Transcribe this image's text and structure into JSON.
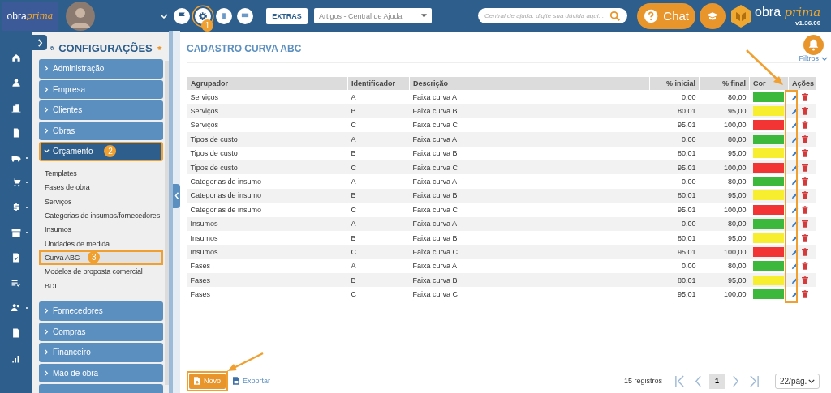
{
  "topbar": {
    "logo": {
      "word": "obra",
      "script": "prima"
    },
    "tools": [
      {
        "kind": "flag",
        "selected": false
      },
      {
        "kind": "gear",
        "selected": true,
        "badge": "1"
      },
      {
        "kind": "phone",
        "selected": false
      },
      {
        "kind": "monitor",
        "selected": false
      }
    ],
    "extras_button": "EXTRAS",
    "help_select": {
      "value": "Artigos - Central de Ajuda"
    },
    "help_search": {
      "placeholder": "Central de ajuda: digite sua dúvida aqui..."
    },
    "chat_button": "Chat",
    "brand": {
      "word": "obra",
      "script": "prima",
      "version": "v1.36.00"
    }
  },
  "rail": [
    {
      "kind": "home",
      "submenu": false
    },
    {
      "kind": "user",
      "submenu": false
    },
    {
      "kind": "building",
      "submenu": false
    },
    {
      "kind": "invoice",
      "submenu": false
    },
    {
      "kind": "truck",
      "submenu": true
    },
    {
      "kind": "cart",
      "submenu": true
    },
    {
      "kind": "dollar",
      "submenu": true
    },
    {
      "kind": "archive",
      "submenu": true
    },
    {
      "kind": "doc-check",
      "submenu": false
    },
    {
      "kind": "list-check",
      "submenu": false
    },
    {
      "kind": "people",
      "submenu": true
    },
    {
      "kind": "doc",
      "submenu": false
    },
    {
      "kind": "chart",
      "submenu": false
    }
  ],
  "sidebar": {
    "title": "CONFIGURAÇÕES",
    "sections": [
      {
        "label": "Administração",
        "expanded": false
      },
      {
        "label": "Empresa",
        "expanded": false
      },
      {
        "label": "Clientes",
        "expanded": false
      },
      {
        "label": "Obras",
        "expanded": false
      },
      {
        "label": "Orçamento",
        "expanded": true,
        "badge": "2",
        "children": [
          {
            "label": "Templates",
            "selected": false
          },
          {
            "label": "Fases de obra",
            "selected": false
          },
          {
            "label": "Serviços",
            "selected": false
          },
          {
            "label": "Categorias de insumos/fornecedores",
            "selected": false
          },
          {
            "label": "Insumos",
            "selected": false
          },
          {
            "label": "Unidades de medida",
            "selected": false
          },
          {
            "label": "Curva ABC",
            "selected": true,
            "badge": "3"
          },
          {
            "label": "Modelos de proposta comercial",
            "selected": false
          },
          {
            "label": "BDI",
            "selected": false
          }
        ]
      },
      {
        "label": "Fornecedores",
        "expanded": false
      },
      {
        "label": "Compras",
        "expanded": false
      },
      {
        "label": "Financeiro",
        "expanded": false
      },
      {
        "label": "Mão de obra",
        "expanded": false
      }
    ]
  },
  "page": {
    "title": "CADASTRO CURVA ABC",
    "filters": "Filtros",
    "table": {
      "actions_highlighted": true,
      "columns": [
        "Agrupador",
        "Identificador",
        "Descrição",
        "% inicial",
        "% final",
        "Cor",
        "Ações"
      ],
      "rows": [
        {
          "group": "Serviços",
          "id": "A",
          "description": "Faixa curva A",
          "start": "0,00",
          "end": "80,00",
          "color": "#3cb83c"
        },
        {
          "group": "Serviços",
          "id": "B",
          "description": "Faixa curva B",
          "start": "80,01",
          "end": "95,00",
          "color": "#f7ee2f"
        },
        {
          "group": "Serviços",
          "id": "C",
          "description": "Faixa curva C",
          "start": "95,01",
          "end": "100,00",
          "color": "#f23434"
        },
        {
          "group": "Tipos de custo",
          "id": "A",
          "description": "Faixa curva A",
          "start": "0,00",
          "end": "80,00",
          "color": "#3cb83c"
        },
        {
          "group": "Tipos de custo",
          "id": "B",
          "description": "Faixa curva B",
          "start": "80,01",
          "end": "95,00",
          "color": "#f7ee2f"
        },
        {
          "group": "Tipos de custo",
          "id": "C",
          "description": "Faixa curva C",
          "start": "95,01",
          "end": "100,00",
          "color": "#f23434"
        },
        {
          "group": "Categorias de insumo",
          "id": "A",
          "description": "Faixa curva A",
          "start": "0,00",
          "end": "80,00",
          "color": "#3cb83c"
        },
        {
          "group": "Categorias de insumo",
          "id": "B",
          "description": "Faixa curva B",
          "start": "80,01",
          "end": "95,00",
          "color": "#f7ee2f"
        },
        {
          "group": "Categorias de insumo",
          "id": "C",
          "description": "Faixa curva C",
          "start": "95,01",
          "end": "100,00",
          "color": "#f23434"
        },
        {
          "group": "Insumos",
          "id": "A",
          "description": "Faixa curva A",
          "start": "0,00",
          "end": "80,00",
          "color": "#3cb83c"
        },
        {
          "group": "Insumos",
          "id": "B",
          "description": "Faixa curva B",
          "start": "80,01",
          "end": "95,00",
          "color": "#f7ee2f"
        },
        {
          "group": "Insumos",
          "id": "C",
          "description": "Faixa curva C",
          "start": "95,01",
          "end": "100,00",
          "color": "#f23434"
        },
        {
          "group": "Fases",
          "id": "A",
          "description": "Faixa curva A",
          "start": "0,00",
          "end": "80,00",
          "color": "#3cb83c"
        },
        {
          "group": "Fases",
          "id": "B",
          "description": "Faixa curva B",
          "start": "80,01",
          "end": "95,00",
          "color": "#f7ee2f"
        },
        {
          "group": "Fases",
          "id": "C",
          "description": "Faixa curva C",
          "start": "95,01",
          "end": "100,00",
          "color": "#3cb83c"
        }
      ]
    },
    "footer": {
      "new_button": {
        "label": "Novo",
        "highlighted": true
      },
      "export_link": "Exportar",
      "record_count": "15 registros",
      "pages": [
        {
          "label": "1",
          "selected": true
        }
      ],
      "page_size": "22/pág."
    }
  }
}
